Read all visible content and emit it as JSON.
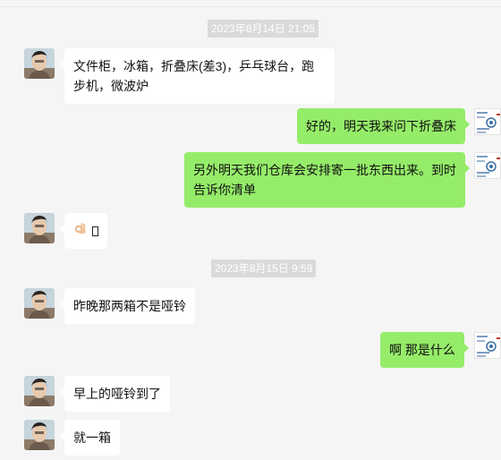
{
  "timestamps": [
    "2023年8月14日 21:05",
    "2023年8月15日 9:59"
  ],
  "messages": [
    {
      "side": "left",
      "text": "文件柜，冰箱，折叠床(差3)，乒乓球台，跑步机，微波炉"
    },
    {
      "side": "right",
      "text": "好的，明天我来问下折叠床"
    },
    {
      "side": "right",
      "text": "另外明天我们仓库会安排寄一批东西出来。到时告诉你清单"
    },
    {
      "side": "left",
      "type": "emoji",
      "emoji": "ok-hand-emoji",
      "text": ""
    },
    {
      "side": "left",
      "text": "昨晚那两箱不是哑铃"
    },
    {
      "side": "right",
      "text": "啊 那是什么"
    },
    {
      "side": "left",
      "text": "早上的哑铃到了"
    },
    {
      "side": "left",
      "text": "就一箱"
    }
  ],
  "colors": {
    "background": "#f5f5f5",
    "self_bubble": "#95ec69",
    "other_bubble": "#ffffff",
    "timestamp_bg": "#dadada"
  }
}
